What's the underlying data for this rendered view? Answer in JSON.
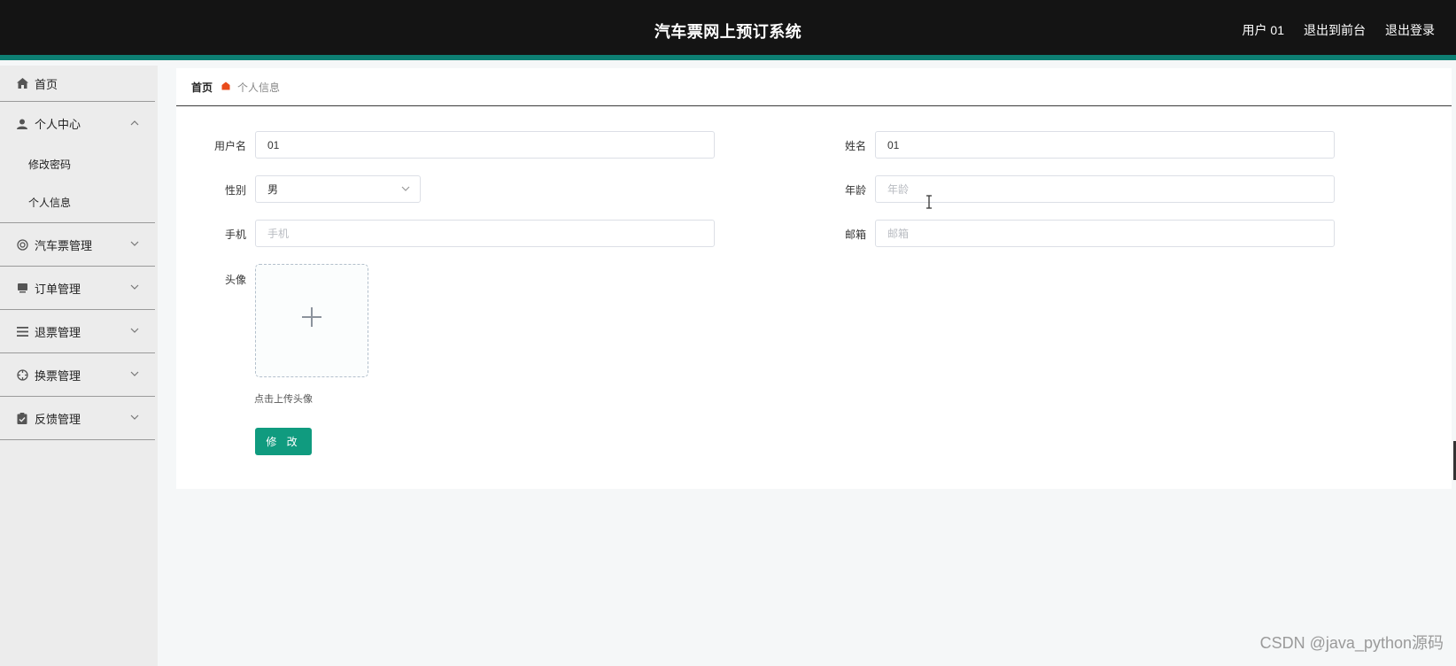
{
  "header": {
    "title": "汽车票网上预订系统",
    "user_label": "用户 01",
    "front_label": "退出到前台",
    "logout_label": "退出登录"
  },
  "sidebar": {
    "home": "首页",
    "personal_center": "个人中心",
    "change_password": "修改密码",
    "personal_info": "个人信息",
    "bus_ticket_mgmt": "汽车票管理",
    "order_mgmt": "订单管理",
    "refund_mgmt": "退票管理",
    "exchange_mgmt": "换票管理",
    "feedback_mgmt": "反馈管理"
  },
  "breadcrumb": {
    "home": "首页",
    "current": "个人信息"
  },
  "form": {
    "username_label": "用户名",
    "username_value": "01",
    "name_label": "姓名",
    "name_value": "01",
    "gender_label": "性别",
    "gender_value": "男",
    "age_label": "年龄",
    "age_placeholder": "年龄",
    "phone_label": "手机",
    "phone_placeholder": "手机",
    "email_label": "邮箱",
    "email_placeholder": "邮箱",
    "avatar_label": "头像",
    "upload_tip": "点击上传头像",
    "submit_label": "修 改"
  },
  "watermark": "CSDN @java_python源码",
  "colors": {
    "header_bg": "#141414",
    "accent_bar": "#0d7f73",
    "button": "#109b7f",
    "breadcrumb_icon": "#e94b1b"
  }
}
